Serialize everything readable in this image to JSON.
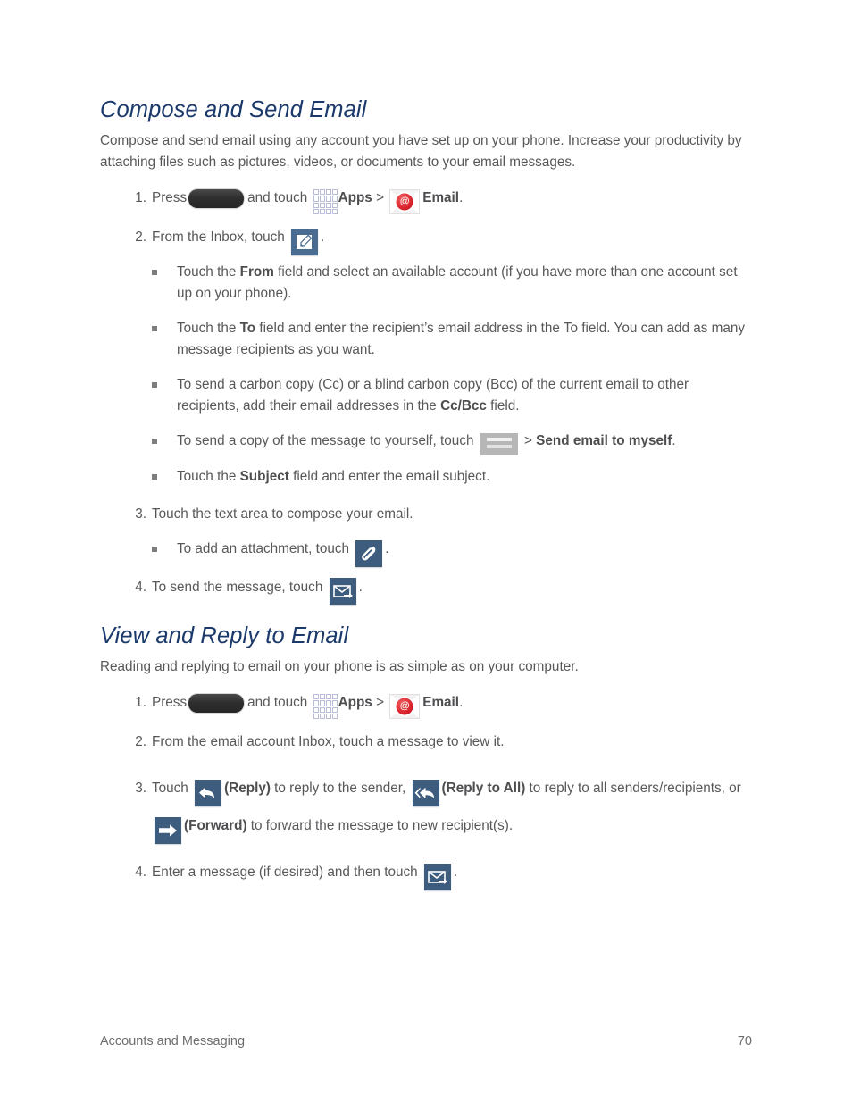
{
  "document": {
    "footer_left": "Accounts and Messaging",
    "page_number": "70"
  },
  "colors": {
    "heading": "#1b3a6b",
    "body_text": "#58585b",
    "icon_blue": "#3e5c7e",
    "email_badge_red": "#d8202a",
    "menu_gray": "#b6b6b6"
  },
  "sections": [
    {
      "heading": "Compose and Send Email",
      "intro": "Compose and send email using any account you have set up on your phone. Increase your productivity by attaching files such as pictures, videos, or documents to your email messages.",
      "steps": [
        {
          "number": "1.",
          "parts": {
            "press": "Press",
            "and_touch": "and touch",
            "apps_label": "Apps",
            "separator": ">",
            "email_label": "Email",
            "period": "."
          },
          "icons": [
            "home-key-icon",
            "apps-grid-icon",
            "email-envelope-icon"
          ]
        },
        {
          "number": "2.",
          "parts": {
            "lead": "From the Inbox, touch",
            "period": "."
          },
          "icons": [
            "compose-icon"
          ],
          "substeps": [
            {
              "pre": "Touch the ",
              "bold": "From",
              "post": " field and select an available account (if you have more than one account set up on your phone)."
            },
            {
              "pre": "Touch the ",
              "bold": "To",
              "post": " field and enter the recipient’s email address in the To field. You can add as many message recipients as you want."
            },
            {
              "pre": "To send a carbon copy (Cc) or a blind carbon copy (Bcc) of the current email to other recipients, add their email addresses in the ",
              "bold": "Cc/Bcc",
              "post": " field."
            },
            {
              "pre": "To send a copy of the message to yourself, touch ",
              "icon": "menu-icon",
              "mid": " > ",
              "bold": "Send email to myself",
              "post": "."
            },
            {
              "pre": "Touch the ",
              "bold": "Subject",
              "post": " field and enter the email subject."
            }
          ]
        },
        {
          "number": "3.",
          "parts": {
            "lead": "Touch the text area to compose your email."
          },
          "substeps": [
            {
              "pre": "To add an attachment, touch ",
              "icon": "attachment-icon",
              "post": "."
            }
          ]
        },
        {
          "number": "4.",
          "parts": {
            "lead": "To send the message, touch",
            "period": "."
          },
          "icons": [
            "send-icon"
          ]
        }
      ]
    },
    {
      "heading": "View and Reply to Email",
      "intro": "Reading and replying to email on your phone is as simple as on your computer.",
      "steps": [
        {
          "number": "1.",
          "parts": {
            "press": "Press",
            "and_touch": "and touch",
            "apps_label": "Apps",
            "separator": ">",
            "email_label": "Email",
            "period": "."
          },
          "icons": [
            "home-key-icon",
            "apps-grid-icon",
            "email-envelope-icon"
          ]
        },
        {
          "number": "2.",
          "parts": {
            "lead": "From the email account Inbox, touch a message to view it."
          }
        },
        {
          "number": "3.",
          "parts": {
            "t1": "Touch ",
            "b1": "(Reply)",
            "t2": " to reply to the sender, ",
            "b2": "(Reply to All)",
            "t3": " to reply to all senders/recipients, or ",
            "b3": "(Forward)",
            "t4": " to forward the message to new recipient(s)."
          },
          "icons": [
            "reply-icon",
            "reply-all-icon",
            "forward-icon"
          ]
        },
        {
          "number": "4.",
          "parts": {
            "lead": "Enter a message (if desired) and then touch",
            "period": "."
          },
          "icons": [
            "send-icon"
          ]
        }
      ]
    }
  ]
}
